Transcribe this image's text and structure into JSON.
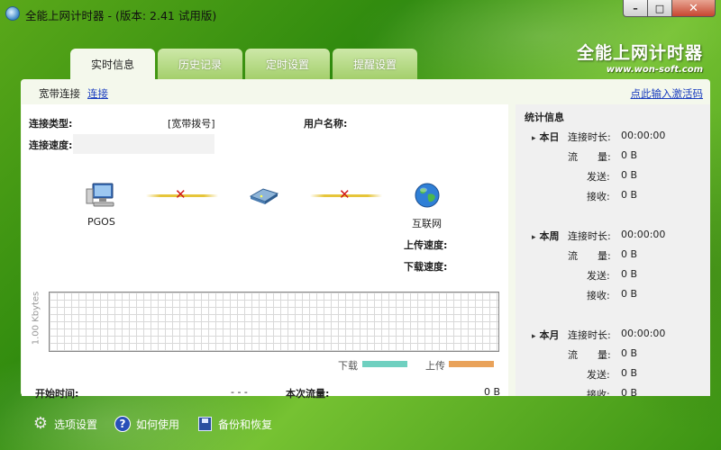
{
  "window": {
    "title": "全能上网计时器 - (版本: 2.41 试用版)",
    "min": "–",
    "max": "□",
    "close": "✕"
  },
  "brand": {
    "title": "全能上网计时器",
    "url": "www.won-soft.com"
  },
  "tabs": [
    {
      "label": "实时信息",
      "active": true
    },
    {
      "label": "历史记录"
    },
    {
      "label": "定时设置"
    },
    {
      "label": "提醒设置"
    }
  ],
  "subbar": {
    "label": "宽带连接",
    "connect_link": "连接",
    "activate_link": "点此输入激活码"
  },
  "realtime": {
    "conn_type_label": "连接类型:",
    "conn_type_value": "[宽带拨号]",
    "username_label": "用户名称:",
    "speed_label": "连接速度:",
    "local_name": "PGOS",
    "internet_label": "互联网",
    "upload_label": "上传速度:",
    "download_label": "下载速度:",
    "x1": "✕",
    "x2": "✕",
    "graph_unit": "1.00 Kbytes",
    "legend_download": "下载",
    "legend_upload": "上传",
    "start_label": "开始时间:",
    "start_value": "- - -",
    "flow_label": "本次流量:",
    "flow_value": "0 B"
  },
  "stats": {
    "title": "统计信息",
    "periods": [
      {
        "name": "本日",
        "duration_label": "连接时长:",
        "duration": "00:00:00",
        "flow_label": "流　　量:",
        "flow": "0 B",
        "sent_label": "发送:",
        "sent": "0 B",
        "recv_label": "接收:",
        "recv": "0 B"
      },
      {
        "name": "本周",
        "duration_label": "连接时长:",
        "duration": "00:00:00",
        "flow_label": "流　　量:",
        "flow": "0 B",
        "sent_label": "发送:",
        "sent": "0 B",
        "recv_label": "接收:",
        "recv": "0 B"
      },
      {
        "name": "本月",
        "duration_label": "连接时长:",
        "duration": "00:00:00",
        "flow_label": "流　　量:",
        "flow": "0 B",
        "sent_label": "发送:",
        "sent": "0 B",
        "recv_label": "接收:",
        "recv": "0 B"
      }
    ]
  },
  "bottom": {
    "options": "选项设置",
    "help": "如何使用",
    "backup": "备份和恢复"
  },
  "colors": {
    "download": "#6fd0c0",
    "upload": "#e9a25a",
    "link": "#1a3dbf"
  }
}
